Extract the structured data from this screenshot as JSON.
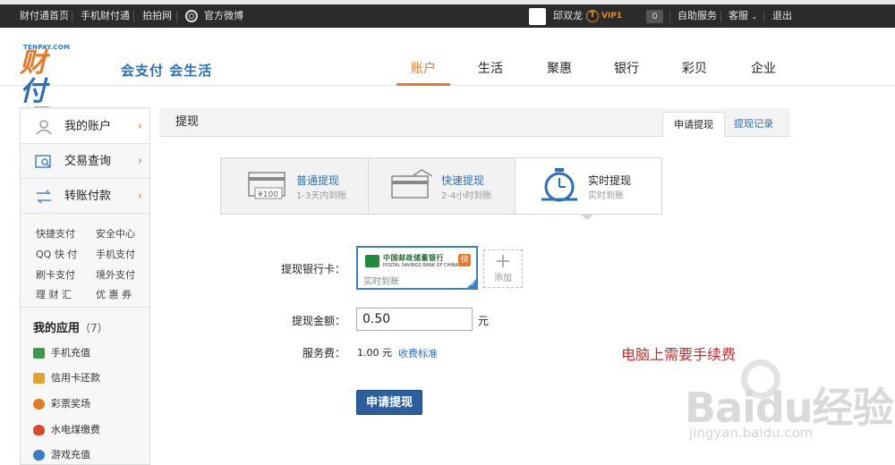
{
  "topbar": {
    "links": [
      "财付通首页",
      "手机财付通",
      "拍拍网",
      "官方微博"
    ],
    "user_name": "邱双龙",
    "vip_label": "VIP1",
    "message_count": "0",
    "self_service": "自助服务",
    "customer_service": "客服",
    "logout": "退出"
  },
  "header": {
    "logo_small": "TENPAY.COM",
    "logo_text_a": "财",
    "logo_text_b": "付通",
    "slogan": "会支付 会生活",
    "nav": [
      "账户",
      "生活",
      "聚惠",
      "银行",
      "彩贝",
      "企业"
    ],
    "nav_active": "账户"
  },
  "sidebar": {
    "main_items": [
      {
        "label": "我的账户",
        "icon": "user-icon"
      },
      {
        "label": "交易查询",
        "icon": "search-icon"
      },
      {
        "label": "转账付款",
        "icon": "transfer-icon"
      }
    ],
    "links": [
      "快捷支付",
      "安全中心",
      "QQ 快 付",
      "手机支付",
      "刷卡支付",
      "境外支付",
      "理 财 汇",
      "优 惠 券"
    ],
    "apps_title": "我的应用",
    "apps_count": "（7）",
    "apps": [
      {
        "label": "手机充值",
        "color": "#3b9b4a"
      },
      {
        "label": "信用卡还款",
        "color": "#e3a42a"
      },
      {
        "label": "彩票奖场",
        "color": "#e07b1f"
      },
      {
        "label": "水电煤缴费",
        "color": "#d9482b"
      },
      {
        "label": "游戏充值",
        "color": "#3a7bc8"
      }
    ]
  },
  "panel": {
    "title": "提现",
    "tabs": [
      "申请提现",
      "提现记录"
    ],
    "active_tab": "申请提现"
  },
  "withdraw_types": [
    {
      "name": "普通提现",
      "desc": "1-3天内到账",
      "icon": "card-cash-icon"
    },
    {
      "name": "快速提现",
      "desc": "2-4小时到账",
      "icon": "card-fast-icon"
    },
    {
      "name": "实时提现",
      "desc": "实时到账",
      "icon": "stopwatch-icon"
    }
  ],
  "selected_type": "实时提现",
  "form": {
    "bank_label": "提现银行卡：",
    "bank_name": "中国邮政储蓄银行",
    "bank_name_en": "POSTAL SAVINGS BANK OF CHINA",
    "bank_badge": "快",
    "bank_tag": "实时到账",
    "add_label": "添加",
    "amount_label": "提现金额：",
    "amount_value": "0.50",
    "amount_unit": "元",
    "fee_label": "服务费：",
    "fee_value": "1.00 元",
    "fee_link": "收费标准",
    "submit": "申请提现"
  },
  "annotation": "电脑上需要手续费",
  "watermark": {
    "text": "Baidu经验",
    "sub": "jingyan.baidu.com"
  },
  "colors": {
    "accent_orange": "#e8792a",
    "link_blue": "#2a6fb8",
    "button_blue": "#2c5f9e",
    "note_red": "#c82a2a"
  }
}
